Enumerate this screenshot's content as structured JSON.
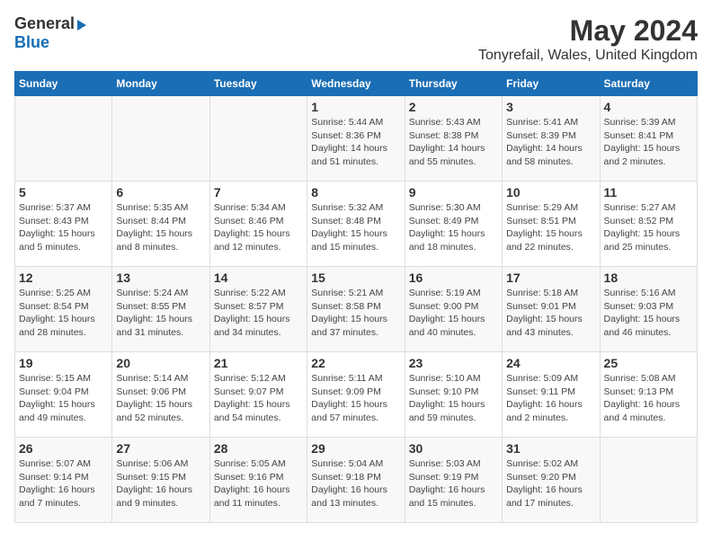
{
  "logo": {
    "line1": "General",
    "line2": "Blue"
  },
  "title": "May 2024",
  "subtitle": "Tonyrefail, Wales, United Kingdom",
  "days_of_week": [
    "Sunday",
    "Monday",
    "Tuesday",
    "Wednesday",
    "Thursday",
    "Friday",
    "Saturday"
  ],
  "weeks": [
    [
      {
        "day": "",
        "info": ""
      },
      {
        "day": "",
        "info": ""
      },
      {
        "day": "",
        "info": ""
      },
      {
        "day": "1",
        "info": "Sunrise: 5:44 AM\nSunset: 8:36 PM\nDaylight: 14 hours\nand 51 minutes."
      },
      {
        "day": "2",
        "info": "Sunrise: 5:43 AM\nSunset: 8:38 PM\nDaylight: 14 hours\nand 55 minutes."
      },
      {
        "day": "3",
        "info": "Sunrise: 5:41 AM\nSunset: 8:39 PM\nDaylight: 14 hours\nand 58 minutes."
      },
      {
        "day": "4",
        "info": "Sunrise: 5:39 AM\nSunset: 8:41 PM\nDaylight: 15 hours\nand 2 minutes."
      }
    ],
    [
      {
        "day": "5",
        "info": "Sunrise: 5:37 AM\nSunset: 8:43 PM\nDaylight: 15 hours\nand 5 minutes."
      },
      {
        "day": "6",
        "info": "Sunrise: 5:35 AM\nSunset: 8:44 PM\nDaylight: 15 hours\nand 8 minutes."
      },
      {
        "day": "7",
        "info": "Sunrise: 5:34 AM\nSunset: 8:46 PM\nDaylight: 15 hours\nand 12 minutes."
      },
      {
        "day": "8",
        "info": "Sunrise: 5:32 AM\nSunset: 8:48 PM\nDaylight: 15 hours\nand 15 minutes."
      },
      {
        "day": "9",
        "info": "Sunrise: 5:30 AM\nSunset: 8:49 PM\nDaylight: 15 hours\nand 18 minutes."
      },
      {
        "day": "10",
        "info": "Sunrise: 5:29 AM\nSunset: 8:51 PM\nDaylight: 15 hours\nand 22 minutes."
      },
      {
        "day": "11",
        "info": "Sunrise: 5:27 AM\nSunset: 8:52 PM\nDaylight: 15 hours\nand 25 minutes."
      }
    ],
    [
      {
        "day": "12",
        "info": "Sunrise: 5:25 AM\nSunset: 8:54 PM\nDaylight: 15 hours\nand 28 minutes."
      },
      {
        "day": "13",
        "info": "Sunrise: 5:24 AM\nSunset: 8:55 PM\nDaylight: 15 hours\nand 31 minutes."
      },
      {
        "day": "14",
        "info": "Sunrise: 5:22 AM\nSunset: 8:57 PM\nDaylight: 15 hours\nand 34 minutes."
      },
      {
        "day": "15",
        "info": "Sunrise: 5:21 AM\nSunset: 8:58 PM\nDaylight: 15 hours\nand 37 minutes."
      },
      {
        "day": "16",
        "info": "Sunrise: 5:19 AM\nSunset: 9:00 PM\nDaylight: 15 hours\nand 40 minutes."
      },
      {
        "day": "17",
        "info": "Sunrise: 5:18 AM\nSunset: 9:01 PM\nDaylight: 15 hours\nand 43 minutes."
      },
      {
        "day": "18",
        "info": "Sunrise: 5:16 AM\nSunset: 9:03 PM\nDaylight: 15 hours\nand 46 minutes."
      }
    ],
    [
      {
        "day": "19",
        "info": "Sunrise: 5:15 AM\nSunset: 9:04 PM\nDaylight: 15 hours\nand 49 minutes."
      },
      {
        "day": "20",
        "info": "Sunrise: 5:14 AM\nSunset: 9:06 PM\nDaylight: 15 hours\nand 52 minutes."
      },
      {
        "day": "21",
        "info": "Sunrise: 5:12 AM\nSunset: 9:07 PM\nDaylight: 15 hours\nand 54 minutes."
      },
      {
        "day": "22",
        "info": "Sunrise: 5:11 AM\nSunset: 9:09 PM\nDaylight: 15 hours\nand 57 minutes."
      },
      {
        "day": "23",
        "info": "Sunrise: 5:10 AM\nSunset: 9:10 PM\nDaylight: 15 hours\nand 59 minutes."
      },
      {
        "day": "24",
        "info": "Sunrise: 5:09 AM\nSunset: 9:11 PM\nDaylight: 16 hours\nand 2 minutes."
      },
      {
        "day": "25",
        "info": "Sunrise: 5:08 AM\nSunset: 9:13 PM\nDaylight: 16 hours\nand 4 minutes."
      }
    ],
    [
      {
        "day": "26",
        "info": "Sunrise: 5:07 AM\nSunset: 9:14 PM\nDaylight: 16 hours\nand 7 minutes."
      },
      {
        "day": "27",
        "info": "Sunrise: 5:06 AM\nSunset: 9:15 PM\nDaylight: 16 hours\nand 9 minutes."
      },
      {
        "day": "28",
        "info": "Sunrise: 5:05 AM\nSunset: 9:16 PM\nDaylight: 16 hours\nand 11 minutes."
      },
      {
        "day": "29",
        "info": "Sunrise: 5:04 AM\nSunset: 9:18 PM\nDaylight: 16 hours\nand 13 minutes."
      },
      {
        "day": "30",
        "info": "Sunrise: 5:03 AM\nSunset: 9:19 PM\nDaylight: 16 hours\nand 15 minutes."
      },
      {
        "day": "31",
        "info": "Sunrise: 5:02 AM\nSunset: 9:20 PM\nDaylight: 16 hours\nand 17 minutes."
      },
      {
        "day": "",
        "info": ""
      }
    ]
  ]
}
